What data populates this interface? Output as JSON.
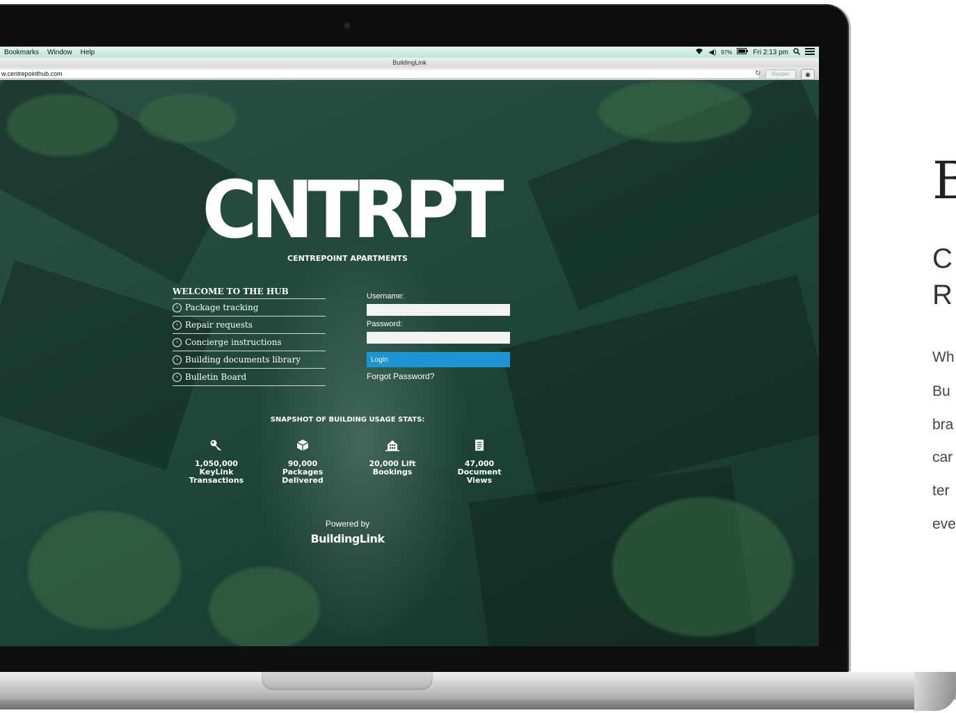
{
  "menubar": {
    "items": [
      "Bookmarks",
      "Window",
      "Help"
    ],
    "battery": "97%",
    "clock": "Fri 2:13 pm"
  },
  "browser": {
    "title": "BuildingLink",
    "url": "w.centrepointhub.com",
    "reader_label": "Reader"
  },
  "site": {
    "logo": "CNTRPT",
    "subtitle": "CENTREPOINT APARTMENTS",
    "welcome_heading": "WELCOME TO THE HUB",
    "features": [
      "Package tracking",
      "Repair requests",
      "Concierge instructions",
      "Building documents library",
      "Bulletin Board"
    ],
    "login": {
      "username_label": "Username:",
      "password_label": "Password:",
      "login_button": "Login",
      "forgot": "Forgot Password?"
    },
    "stats_heading": "SNAPSHOT OF BUILDING USAGE STATS:",
    "stats": [
      {
        "line1": "1,050,000",
        "line2": "KeyLink",
        "line3": "Transactions",
        "icon": "key-icon"
      },
      {
        "line1": "90,000",
        "line2": "Packages",
        "line3": "Delivered",
        "icon": "package-icon"
      },
      {
        "line1": "20,000 Lift",
        "line2": "Bookings",
        "line3": "",
        "icon": "building-icon"
      },
      {
        "line1": "47,000",
        "line2": "Document",
        "line3": "Views",
        "icon": "document-icon"
      }
    ],
    "powered_by": "Powered by",
    "powered_logo": "BuildingLink"
  },
  "side_text": {
    "big_letter": "B",
    "heading_line1": "C",
    "heading_line2": "R",
    "para_lines": [
      "Wh",
      "Bu",
      "bra",
      "car",
      "ter",
      "eve"
    ]
  },
  "colors": {
    "accent": "#1b95d4",
    "page_bg": "#1f4a40"
  }
}
